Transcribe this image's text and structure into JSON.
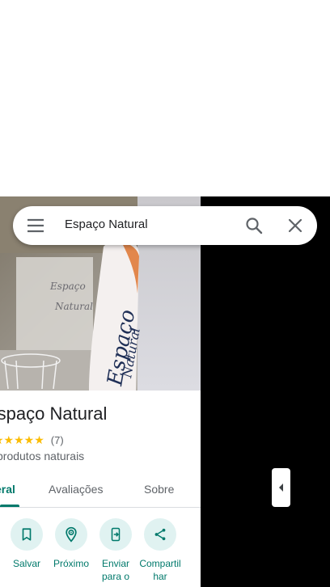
{
  "search": {
    "query": "Espaço Natural"
  },
  "place": {
    "title": "Espaço Natural",
    "photo_sign_text": "Espaço Natural",
    "rating_stars": "★★★★★",
    "rating_count": "(7)",
    "category": "produtos naturais"
  },
  "tabs": [
    {
      "label": "Visão geral",
      "visible_text": "eral",
      "active": true
    },
    {
      "label": "Avaliações",
      "active": false
    },
    {
      "label": "Sobre",
      "active": false
    }
  ],
  "actions": [
    {
      "label": "Salvar",
      "icon": "bookmark-icon"
    },
    {
      "label": "Próximo",
      "icon": "nearby-icon"
    },
    {
      "label": "Enviar para o",
      "icon": "send-to-phone-icon"
    },
    {
      "label": "Compartilhar",
      "visible_text": "Compartil har",
      "icon": "share-icon"
    }
  ],
  "colors": {
    "accent": "#00796b",
    "action_bg": "#e0f2f1",
    "star": "#fbbc04",
    "map_bg": "#000000"
  }
}
